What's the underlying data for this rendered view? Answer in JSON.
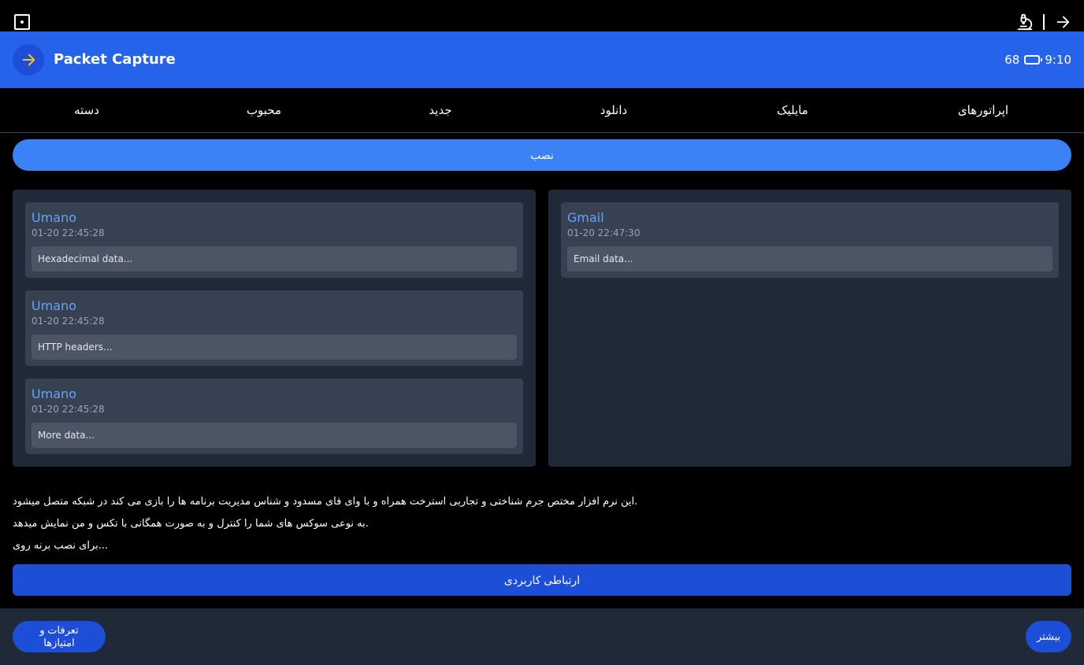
{
  "window": {
    "title": "Packet Capture"
  },
  "status": {
    "battery": "68",
    "time": "9:10"
  },
  "tabs": [
    {
      "label": "دسته"
    },
    {
      "label": "محبوب"
    },
    {
      "label": "جدید"
    },
    {
      "label": "دانلود"
    },
    {
      "label": "مایلیک"
    },
    {
      "label": "اپراتورهای"
    }
  ],
  "install_label": "نصب",
  "left_panel": {
    "cards": [
      {
        "name": "Umano",
        "time": "01-20 22:45:28",
        "data": "Hexadecimal data..."
      },
      {
        "name": "Umano",
        "time": "01-20 22:45:28",
        "data": "HTTP headers..."
      },
      {
        "name": "Umano",
        "time": "01-20 22:45:28",
        "data": "More data..."
      }
    ]
  },
  "right_panel": {
    "cards": [
      {
        "name": "Gmail",
        "time": "01-20 22:47:30",
        "data": "Email data..."
      }
    ]
  },
  "description": {
    "lines": [
      "این نرم افزار مختص جرم شناختی و تجاربی استرخت همراه و با وای فای مسدود و شناس مدیریت برنامه ها را بازی می کند در شبکه متصل میشود.",
      "به نوعی سوکس های شما را کنترل و به صورت همگانی با تکس و من نمایش میدهد.",
      "برای نصب برنه روی..."
    ]
  },
  "connect_label": "ارتباطی کاربردی",
  "footer": {
    "left_label": "تعرفات و امتیازها",
    "right_label": "بیشتر"
  },
  "icons": {
    "top_left": "square-dot-icon",
    "top_right_1": "microscope-icon",
    "top_right_2": "arrow-right-icon",
    "header_back": "arrow-right-icon",
    "battery": "battery-icon"
  },
  "colors": {
    "header": "#2563eb",
    "accent": "#3b82f6",
    "button": "#1d4ed8",
    "panel": "#1f2937",
    "card": "#374151",
    "card_name": "#60a5fa",
    "back_arrow": "#fbbf24"
  }
}
